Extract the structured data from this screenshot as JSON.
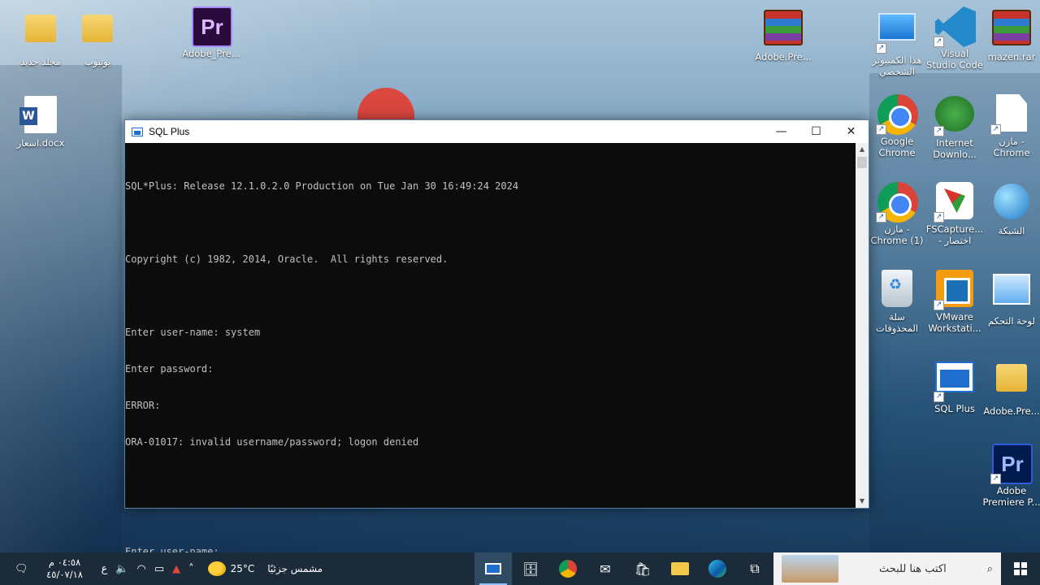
{
  "desktop": {
    "icons": [
      {
        "label": "مجلد جديد"
      },
      {
        "label": "يوتيوب"
      },
      {
        "label": "Adobe_Pre..."
      },
      {
        "label": "اسعار.docx"
      },
      {
        "label": "Adobe.Pre..."
      },
      {
        "label": "هذا الكمبيوتر الشخصي"
      },
      {
        "label": "Visual Studio Code"
      },
      {
        "label": "mazen.rar"
      },
      {
        "label": "Google Chrome"
      },
      {
        "label": "Internet Downlo..."
      },
      {
        "label": "مازن - Chrome"
      },
      {
        "label": "مازن - Chrome (1)"
      },
      {
        "label": "FSCapture... - اختصار"
      },
      {
        "label": "الشبكة"
      },
      {
        "label": "سلة المحذوفات"
      },
      {
        "label": "VMware Workstati..."
      },
      {
        "label": "لوحة التحكم"
      },
      {
        "label": "SQL Plus"
      },
      {
        "label": "Adobe.Pre..."
      },
      {
        "label": "Adobe Premiere P..."
      }
    ]
  },
  "window": {
    "title": "SQL Plus",
    "buttons": {
      "minimize": "—",
      "maximize": "☐",
      "close": "✕"
    },
    "console_lines": [
      "SQL*Plus: Release 12.1.0.2.0 Production on Tue Jan 30 16:49:24 2024",
      "",
      "Copyright (c) 1982, 2014, Oracle.  All rights reserved.",
      "",
      "Enter user-name: system",
      "Enter password:",
      "ERROR:",
      "ORA-01017: invalid username/password; logon denied",
      "",
      "",
      "Enter user-name:"
    ]
  },
  "taskbar": {
    "search_placeholder": "اكتب هنا للبحث",
    "weather_temp": "25°C",
    "weather_text": "مشمس جزئيًا",
    "language": "ع",
    "clock_time": "٠٤:٥٨ م",
    "clock_date": "٤٥/٠٧/١٨"
  }
}
